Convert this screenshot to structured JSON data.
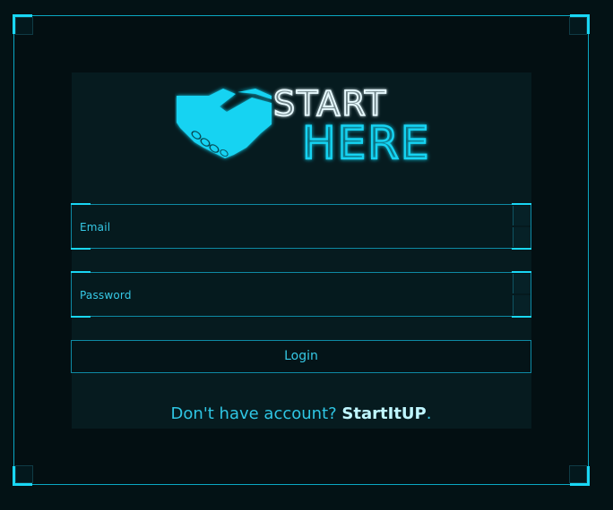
{
  "logo": {
    "line1": "START",
    "line2": "HERE",
    "icon": "handshake-icon"
  },
  "form": {
    "email_label": "Email",
    "password_label": "Password",
    "login_label": "Login"
  },
  "signup": {
    "prompt": "Don't have account? ",
    "link_text": "StartItUP",
    "suffix": "."
  },
  "colors": {
    "background": "#031215",
    "panel": "#061b1f",
    "accent": "#19d7f5",
    "text": "#36c9e6",
    "link": "#bff6ff"
  }
}
